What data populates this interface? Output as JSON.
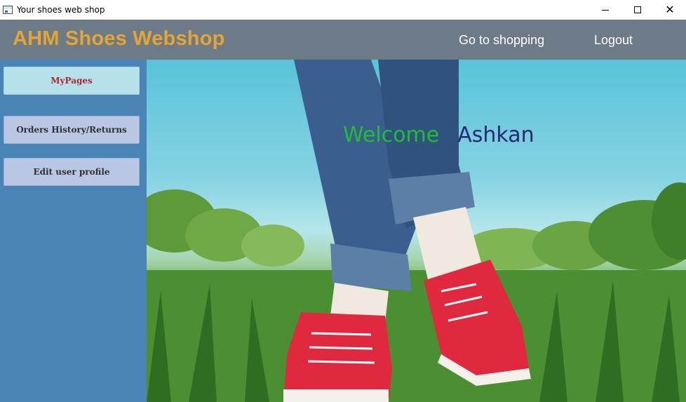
{
  "window": {
    "title": "Your shoes web shop",
    "controls": {
      "minimize": "minimize",
      "maximize": "maximize",
      "close": "close"
    }
  },
  "header": {
    "brand": "AHM Shoes Webshop",
    "nav": {
      "shopping": "Go to shopping",
      "logout": "Logout"
    }
  },
  "sidebar": {
    "items": [
      {
        "label": "MyPages",
        "active": true
      },
      {
        "label": "Orders  History/Returns",
        "active": false
      },
      {
        "label": "Edit user profile",
        "active": false
      }
    ]
  },
  "main": {
    "welcome_text": "Welcome",
    "user_name": "Ashkan",
    "hero_image": "feet-in-red-sneakers-on-grass"
  },
  "colors": {
    "header_bg": "#6d7a88",
    "brand": "#e5a533",
    "sidebar_bg": "#4a83b6",
    "active_button_bg": "#b5e1ea",
    "active_button_text": "#b0262c",
    "button_bg": "#b9c7e4",
    "welcome": "#1fbe35",
    "user_name": "#2a2577"
  }
}
